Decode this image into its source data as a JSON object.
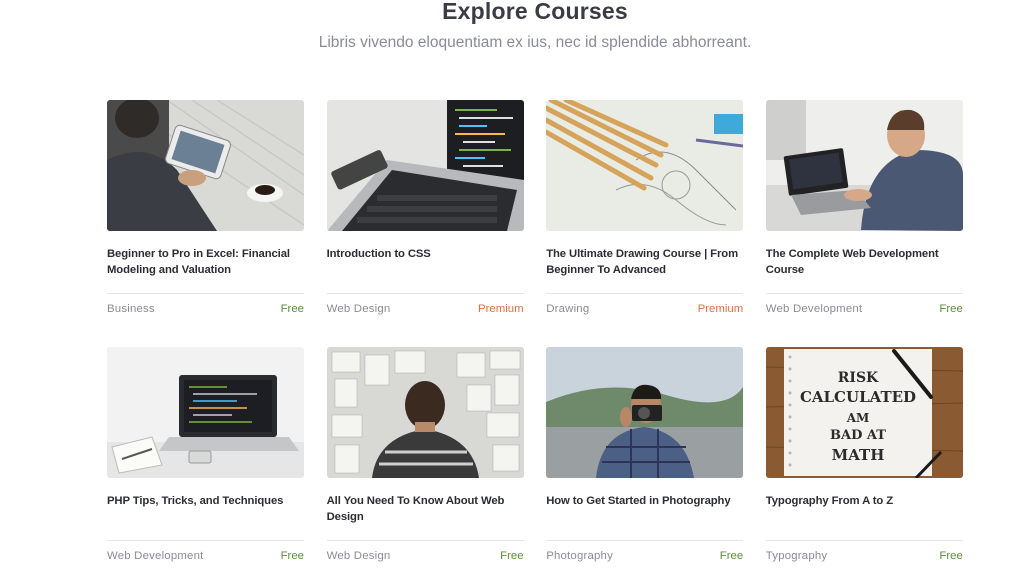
{
  "header": {
    "title": "Explore Courses",
    "subtitle": "Libris vivendo eloquentiam ex ius, nec id splendide abhorreant."
  },
  "colors": {
    "free": "#5b8f3b",
    "premium": "#e0723d"
  },
  "courses": [
    {
      "title": "Beginner to Pro in Excel: Financial Modeling and Valuation",
      "category": "Business",
      "price": "Free",
      "image": "tablet-desk-photo"
    },
    {
      "title": "Introduction to CSS",
      "category": "Web Design",
      "price": "Premium",
      "image": "laptop-code-photo"
    },
    {
      "title": "The Ultimate Drawing Course | From Beginner To Advanced",
      "category": "Drawing",
      "price": "Premium",
      "image": "pencils-sketch-photo"
    },
    {
      "title": "The Complete Web Development Course",
      "category": "Web Development",
      "price": "Free",
      "image": "man-laptop-photo"
    },
    {
      "title": "PHP Tips, Tricks, and Techniques",
      "category": "Web Development",
      "price": "Free",
      "image": "laptop-notebook-photo"
    },
    {
      "title": "All You Need To Know About Web Design",
      "category": "Web Design",
      "price": "Free",
      "image": "wireframe-wall-photo"
    },
    {
      "title": "How to Get Started in Photography",
      "category": "Photography",
      "price": "Free",
      "image": "photographer-photo"
    },
    {
      "title": "Typography From A to Z",
      "category": "Typography",
      "price": "Free",
      "image": "lettering-notebook-photo"
    }
  ],
  "thumb_lettering": [
    "RISK",
    "CALCULATED",
    "AM",
    "BAD AT",
    "MATH"
  ]
}
